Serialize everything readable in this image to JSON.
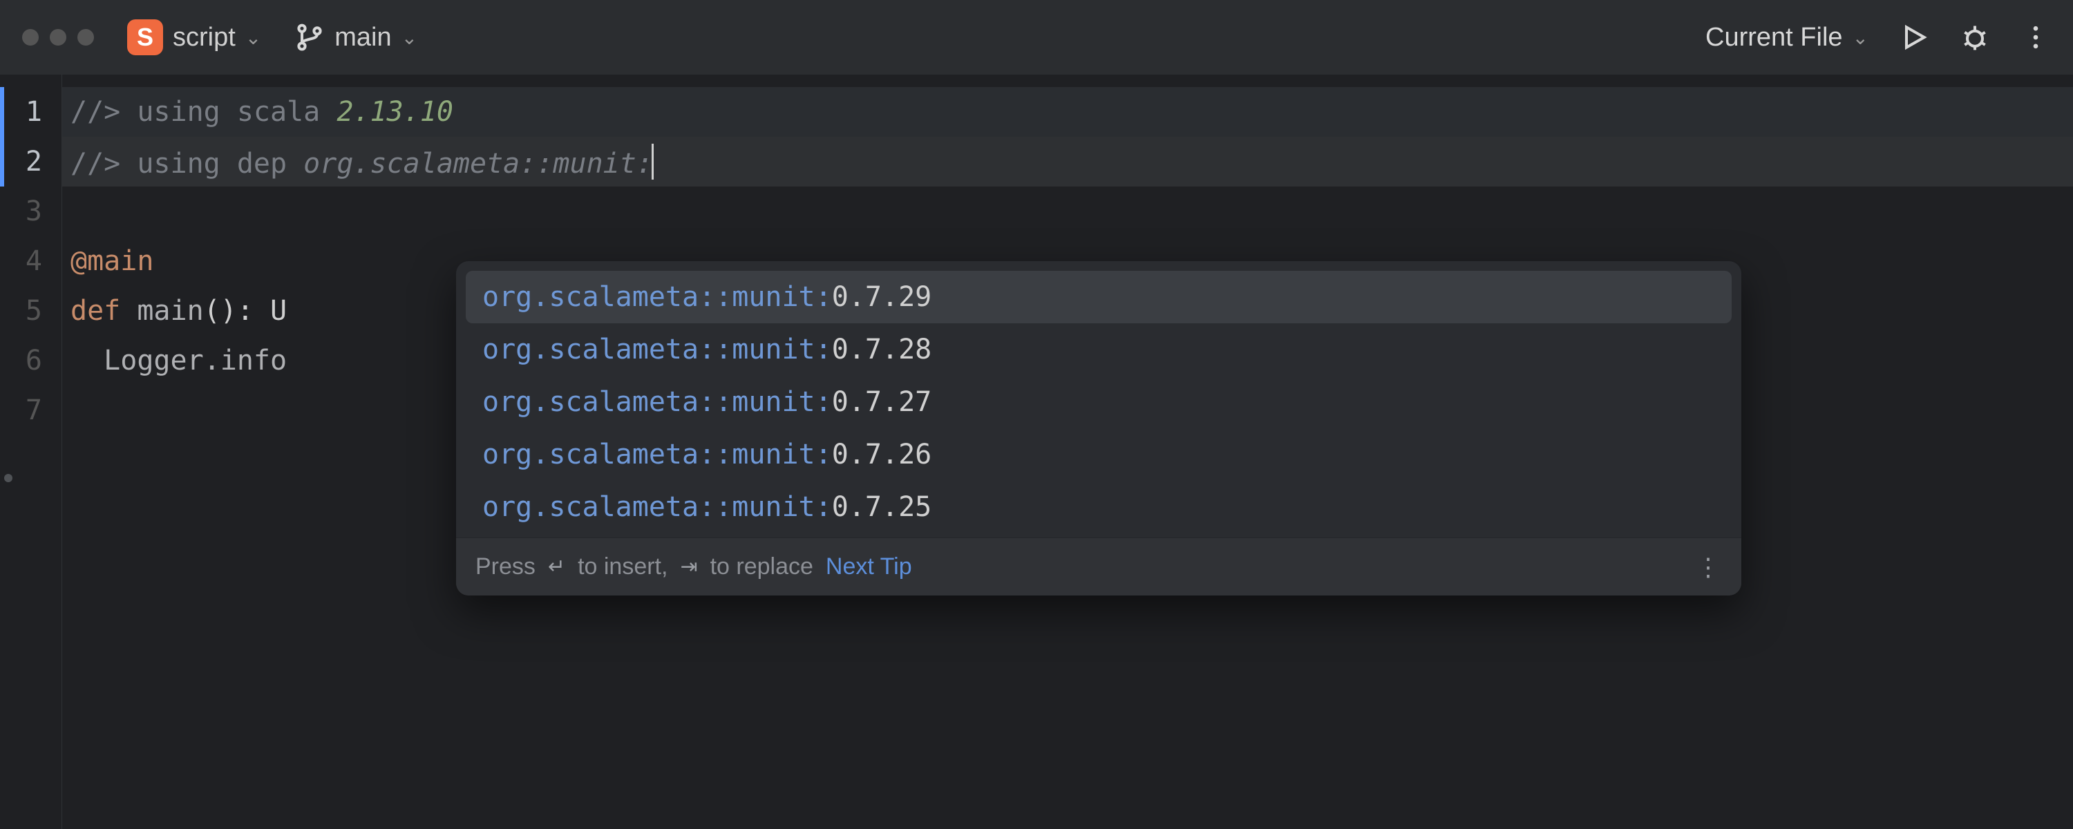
{
  "toolbar": {
    "file_icon_letter": "S",
    "file_name": "script",
    "branch_name": "main",
    "run_config": "Current File"
  },
  "gutter": {
    "lines": [
      "1",
      "2",
      "3",
      "4",
      "5",
      "6",
      "7"
    ],
    "active_line_index": 1
  },
  "code": {
    "line1": {
      "prefix": "//> ",
      "kw": "using",
      "mid": " scala ",
      "lit": "2.13.10"
    },
    "line2": {
      "prefix": "//> ",
      "kw": "using",
      "mid": " dep ",
      "ital": "org.scalameta::munit:"
    },
    "line3": "",
    "line4": "@main",
    "line5": {
      "kw": "def ",
      "fn": "main",
      "rest": "(): U"
    },
    "line6": "  Logger.info",
    "line7": ""
  },
  "popup": {
    "items": [
      {
        "prefix": "org.scalameta::munit:",
        "suffix": "0.7.29",
        "selected": true
      },
      {
        "prefix": "org.scalameta::munit:",
        "suffix": "0.7.28",
        "selected": false
      },
      {
        "prefix": "org.scalameta::munit:",
        "suffix": "0.7.27",
        "selected": false
      },
      {
        "prefix": "org.scalameta::munit:",
        "suffix": "0.7.26",
        "selected": false
      },
      {
        "prefix": "org.scalameta::munit:",
        "suffix": "0.7.25",
        "selected": false
      }
    ],
    "foot_press": "Press ",
    "foot_insert": " to insert, ",
    "foot_replace": " to replace ",
    "foot_enter_glyph": "↵",
    "foot_tab_glyph": "⇥",
    "foot_link": "Next Tip",
    "foot_dots": "⋮"
  }
}
